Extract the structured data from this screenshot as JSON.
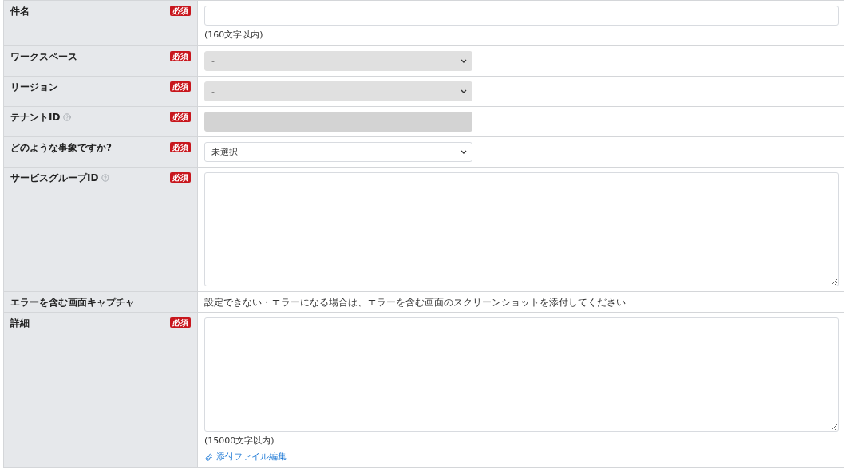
{
  "form": {
    "rows": [
      {
        "label": "件名",
        "required_badge": "必須",
        "help": false,
        "field": {
          "kind": "text",
          "disabled": false
        },
        "note": "(160文字以内)"
      },
      {
        "label": "ワークスペース",
        "required_badge": "必須",
        "help": false,
        "field": {
          "kind": "select",
          "value": "-",
          "disabled": true
        }
      },
      {
        "label": "リージョン",
        "required_badge": "必須",
        "help": false,
        "field": {
          "kind": "select",
          "value": "-",
          "disabled": true
        }
      },
      {
        "label": "テナントID",
        "required_badge": "必須",
        "help": true,
        "field": {
          "kind": "text",
          "disabled": true
        }
      },
      {
        "label": "どのような事象ですか?",
        "required_badge": "必須",
        "help": false,
        "field": {
          "kind": "select",
          "value": "未選択",
          "disabled": false
        }
      },
      {
        "label": "サービスグループID",
        "required_badge": "必須",
        "help": true,
        "field": {
          "kind": "textarea",
          "disabled": false
        }
      },
      {
        "label": "エラーを含む画面キャプチャ",
        "help": false,
        "field": {
          "kind": "message",
          "text": "設定できない・エラーになる場合は、エラーを含む画面のスクリーンショットを添付してください"
        }
      },
      {
        "label": "詳細",
        "required_badge": "必須",
        "help": false,
        "field": {
          "kind": "textarea",
          "disabled": false
        },
        "note": "(15000文字以内)",
        "link": "添付ファイル編集"
      }
    ]
  }
}
